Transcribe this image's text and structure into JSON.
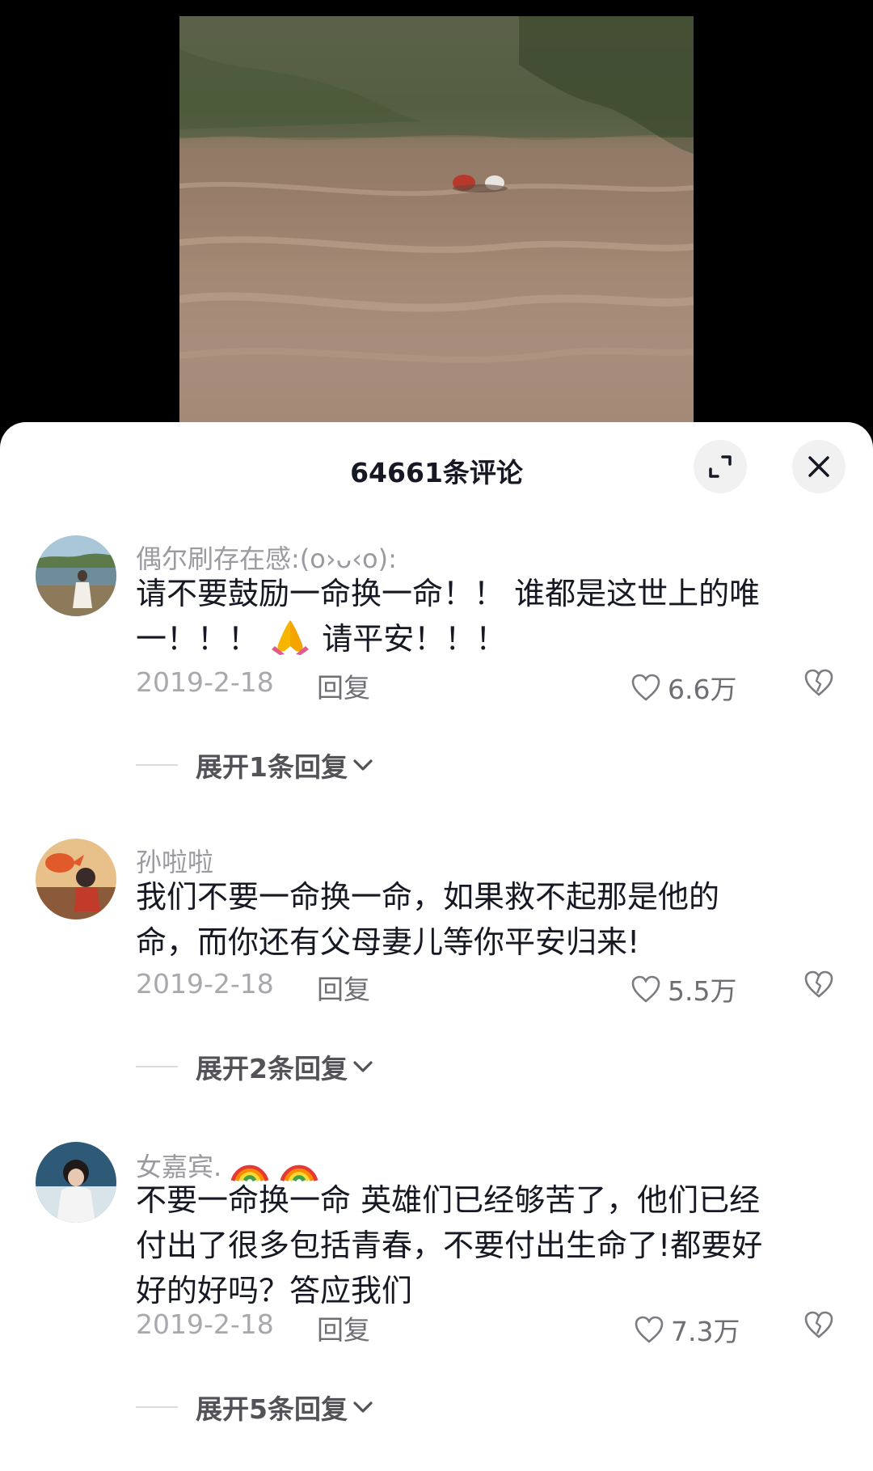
{
  "header": {
    "comment_count_label": "64661条评论"
  },
  "comments": [
    {
      "username": "偶尔刷存在感:(o›ᴗ‹o):",
      "text_line1": "请不要鼓励一命换一命！！ 谁都是这世上的唯",
      "text_line2_a": "一！！！",
      "text_line2_emoji": "folded-hands-emoji",
      "text_line2_b": "请平安！！！",
      "date": "2019-2-18",
      "reply_label": "回复",
      "like_count": "6.6万",
      "expand_label": "展开1条回复"
    },
    {
      "username": "孙啦啦",
      "text_line1": "我们不要一命换一命，如果救不起那是他的",
      "text_line2": "命，而你还有父母妻儿等你平安归来!",
      "date": "2019-2-18",
      "reply_label": "回复",
      "like_count": "5.5万",
      "expand_label": "展开2条回复"
    },
    {
      "username": "女嘉宾.",
      "username_emoji": "rainbow-emoji",
      "text_line1": "不要一命换一命 英雄们已经够苦了，他们已经",
      "text_line2": "付出了很多包括青春，不要付出生命了!都要好",
      "text_line3": "好的好吗？答应我们",
      "date": "2019-2-18",
      "reply_label": "回复",
      "like_count": "7.3万",
      "expand_label": "展开5条回复"
    }
  ],
  "colors": {
    "text_primary": "#161823",
    "text_secondary": "#9a9aa0",
    "sheet_bg": "#ffffff",
    "button_bg": "#f1f1f2"
  }
}
